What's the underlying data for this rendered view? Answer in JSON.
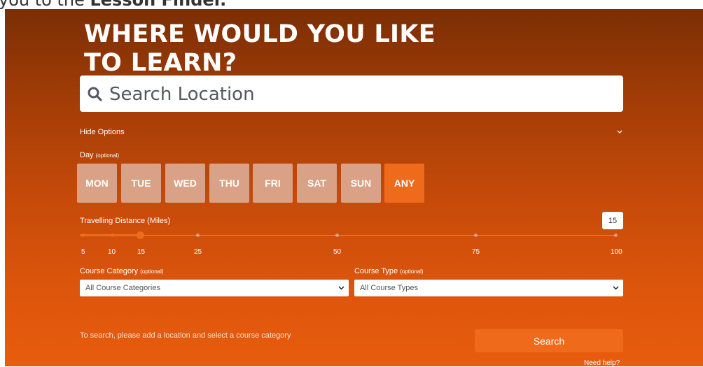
{
  "intro": {
    "text_before": "you to the ",
    "text_bold": "Lesson Finder."
  },
  "headline": {
    "line1": "WHERE WOULD YOU LIKE",
    "line2": "TO LEARN?"
  },
  "search": {
    "placeholder": "Search Location",
    "value": "",
    "icon": "search-icon"
  },
  "options_toggle": {
    "label": "Hide Options",
    "icon": "chevron-down-icon"
  },
  "day": {
    "label": "Day",
    "optional": "(optional)",
    "options": [
      "MON",
      "TUE",
      "WED",
      "THU",
      "FRI",
      "SAT",
      "SUN",
      "ANY"
    ],
    "selected": "ANY"
  },
  "distance": {
    "label": "Travelling Distance (Miles)",
    "value": "15",
    "ticks": [
      "5",
      "10",
      "15",
      "25",
      "50",
      "75",
      "100"
    ]
  },
  "course_category": {
    "label": "Course Category",
    "optional": "(optional)",
    "selected": "All Course Categories"
  },
  "course_type": {
    "label": "Course Type",
    "optional": "(optional)",
    "selected": "All Course Types"
  },
  "footer": {
    "hint": "To search, please add a location and select a course category",
    "search_label": "Search",
    "help_link": "Need help?"
  },
  "colors": {
    "accent": "#f06a1c",
    "day_inactive": "#d9a186",
    "gradient_top": "#7b2e05",
    "gradient_bottom": "#e85c0e"
  }
}
